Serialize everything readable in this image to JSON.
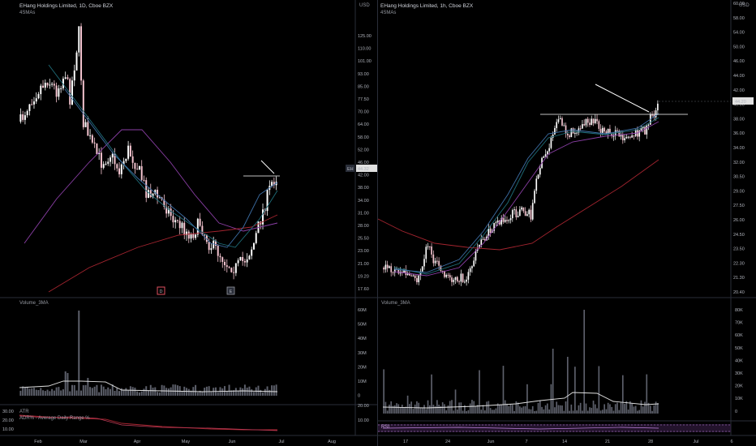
{
  "left": {
    "title": "EHang Holdings Limited, 1D, Cboe BZX",
    "indicator": "4SMAs",
    "currency": "USD",
    "price_ticks": [
      "125.00",
      "110.00",
      "101.00",
      "93.00",
      "85.00",
      "77.50",
      "70.00",
      "64.00",
      "58.00",
      "52.00",
      "46.00",
      "42.00",
      "38.00",
      "34.00",
      "31.00",
      "28.00",
      "25.50",
      "23.00",
      "21.00",
      "19.20",
      "17.60"
    ],
    "last_price": "44.32",
    "last_label": "EH",
    "volume_title": "Volume_3MA",
    "volume_ticks": [
      "60M",
      "50M",
      "40M",
      "30M",
      "20M",
      "10M",
      "0"
    ],
    "atr_title": "ATR",
    "adr_title": "ADR% - Average Daily Range %",
    "atr_ticks": [
      "30.00",
      "20.00",
      "10.00"
    ],
    "atr_right_ticks": [
      "20.00",
      "10.00"
    ],
    "time_ticks": [
      "Feb",
      "Mar",
      "Apr",
      "May",
      "Jun",
      "Jul",
      "Aug"
    ],
    "event_badges": [
      "D",
      "E"
    ],
    "colors": {
      "up": "#ffffff",
      "down": "#f7c6d2",
      "sma_red": "#a3242f",
      "sma_purple": "#8b3fa6",
      "sma_teal": "#1f6e7a",
      "sma_blue": "#3d6fa6"
    }
  },
  "right": {
    "title": "EHang Holdings Limited, 1h, Cboe BZX",
    "indicator": "4SMAs",
    "currency": "USD",
    "price_ticks": [
      "60.00",
      "58.00",
      "54.00",
      "50.00",
      "46.00",
      "44.00",
      "42.00",
      "40.00",
      "38.00",
      "36.00",
      "34.00",
      "32.00",
      "30.50",
      "29.00",
      "27.50",
      "26.00",
      "24.50",
      "23.50",
      "22.30",
      "21.30",
      "20.40"
    ],
    "last_price": "44.20",
    "volume_title": "Volume_3MA",
    "volume_ticks": [
      "80K",
      "70K",
      "60K",
      "50K",
      "40K",
      "30K",
      "20K",
      "10K",
      "0"
    ],
    "rsi_title": "RSI",
    "time_ticks": [
      "17",
      "24",
      "Jun",
      "7",
      "14",
      "21",
      "28",
      "Jul",
      "6"
    ]
  }
}
